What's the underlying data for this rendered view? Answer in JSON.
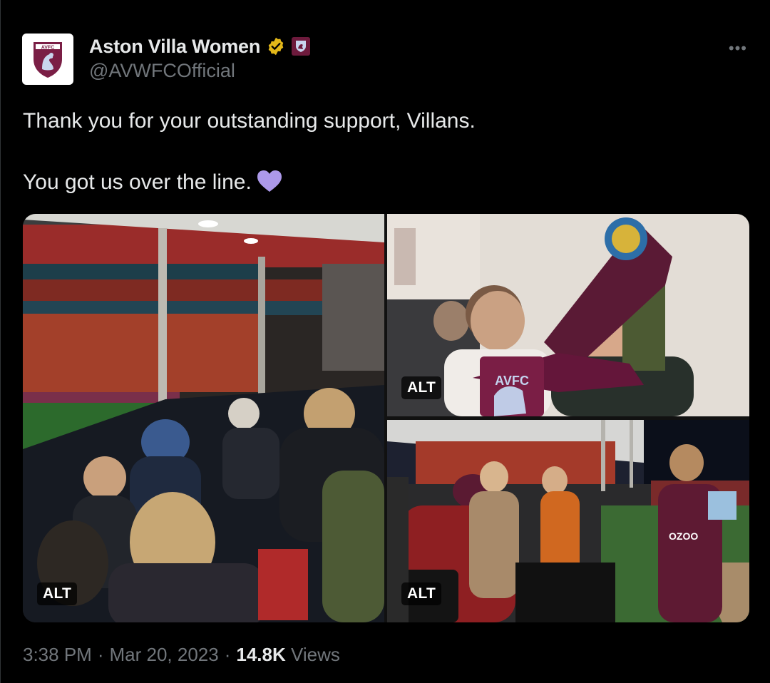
{
  "author": {
    "display_name": "Aston Villa Women",
    "handle": "@AVWFCOfficial",
    "avatar_text": "AVFC"
  },
  "tweet": {
    "line1": "Thank you for your outstanding support, Villans.",
    "line2": "You got us over the line."
  },
  "media": [
    {
      "alt_label": "ALT",
      "icon": "stadium-crowd-photo"
    },
    {
      "alt_label": "ALT",
      "icon": "fans-with-scarves-photo"
    },
    {
      "alt_label": "ALT",
      "icon": "players-meeting-fans-photo"
    }
  ],
  "meta": {
    "time": "3:38 PM",
    "separator": "·",
    "date": "Mar 20, 2023",
    "views_count": "14.8K",
    "views_label": "Views"
  },
  "colors": {
    "background": "#000000",
    "text": "#e7e9ea",
    "muted": "#71767b",
    "verified_gold": "#e2b719",
    "heart": "#ac99ea",
    "claret": "#6d1a3c"
  },
  "icons": {
    "more": "more-icon",
    "verified": "verified-badge-icon",
    "affiliation": "club-crest-icon",
    "heart": "purple-heart-icon"
  }
}
